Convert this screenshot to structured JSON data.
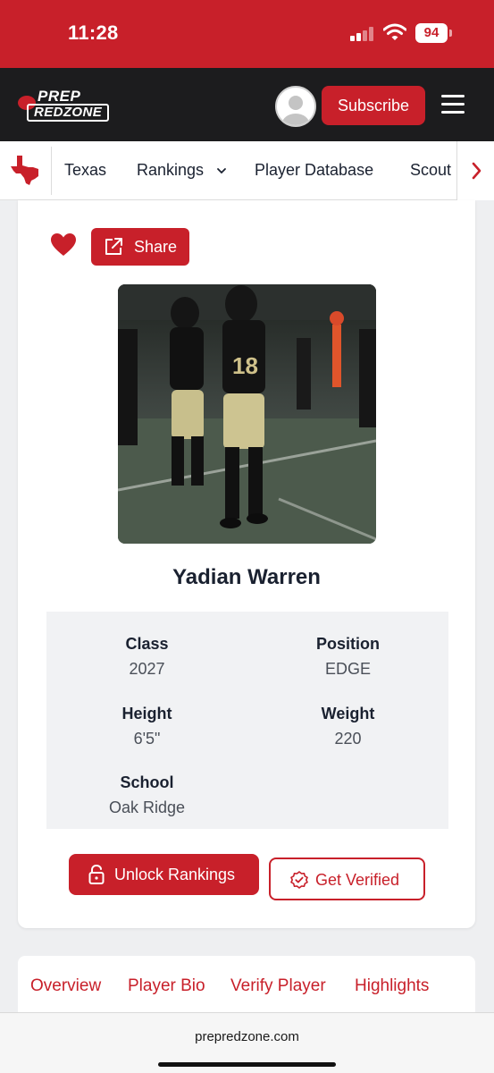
{
  "status_bar": {
    "time": "11:28",
    "battery": "94",
    "icons": [
      "signal-icon",
      "wifi-icon",
      "battery-icon"
    ]
  },
  "header": {
    "logo_line1": "PREP",
    "logo_line2": "REDZONE",
    "subscribe_label": "Subscribe",
    "icons": [
      "avatar",
      "menu-icon"
    ]
  },
  "nav": {
    "state_icon": "texas-state-icon",
    "items": [
      "Texas",
      "Rankings",
      "Player Database",
      "Scout"
    ],
    "icons": [
      "chevron-down-icon",
      "chevron-right-icon"
    ]
  },
  "profile": {
    "share_label": "Share",
    "name": "Yadian Warren",
    "details": {
      "class_label": "Class",
      "class_value": "2027",
      "position_label": "Position",
      "position_value": "EDGE",
      "height_label": "Height",
      "height_value": "6'5\"",
      "weight_label": "Weight",
      "weight_value": "220",
      "school_label": "School",
      "school_value": "Oak Ridge"
    },
    "unlock_label": "Unlock Rankings",
    "verify_label": "Get Verified",
    "icons": [
      "heart-icon",
      "share-icon",
      "unlock-icon",
      "verified-check-icon"
    ]
  },
  "tabs": [
    "Overview",
    "Player Bio",
    "Verify Player",
    "Highlights"
  ],
  "browser": {
    "url": "prepredzone.com"
  },
  "colors": {
    "brand_red": "#c8202a",
    "header_dark": "#1c1c1e",
    "page_bg": "#eeeff1"
  }
}
